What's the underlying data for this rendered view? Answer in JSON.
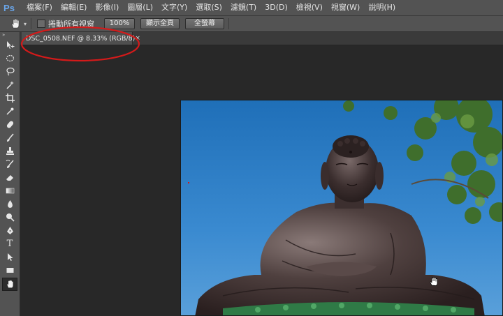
{
  "app": {
    "logo": "Ps"
  },
  "menu": {
    "items": [
      {
        "label": "檔案(F)"
      },
      {
        "label": "編輯(E)"
      },
      {
        "label": "影像(I)"
      },
      {
        "label": "圖層(L)"
      },
      {
        "label": "文字(Y)"
      },
      {
        "label": "選取(S)"
      },
      {
        "label": "濾鏡(T)"
      },
      {
        "label": "3D(D)"
      },
      {
        "label": "檢視(V)"
      },
      {
        "label": "視窗(W)"
      },
      {
        "label": "說明(H)"
      }
    ]
  },
  "options": {
    "scroll_all_windows_label": "捲動所有視窗",
    "zoom_100_label": "100%",
    "fit_screen_label": "顯示全頁",
    "fill_screen_label": "全螢幕"
  },
  "document": {
    "tab_title": "DSC_0508.NEF @ 8.33% (RGB/8)",
    "close_glyph": "×"
  },
  "tools": [
    {
      "icon": "move-icon"
    },
    {
      "icon": "marquee-icon"
    },
    {
      "icon": "lasso-icon"
    },
    {
      "icon": "magic-wand-icon"
    },
    {
      "icon": "crop-icon"
    },
    {
      "icon": "eyedropper-icon"
    },
    {
      "icon": "healing-brush-icon"
    },
    {
      "icon": "brush-icon"
    },
    {
      "icon": "clone-stamp-icon"
    },
    {
      "icon": "history-brush-icon"
    },
    {
      "icon": "eraser-icon"
    },
    {
      "icon": "gradient-icon"
    },
    {
      "icon": "blur-icon"
    },
    {
      "icon": "dodge-icon"
    },
    {
      "icon": "pen-icon"
    },
    {
      "icon": "type-icon",
      "glyph": "T"
    },
    {
      "icon": "path-selection-icon"
    },
    {
      "icon": "rectangle-shape-icon"
    },
    {
      "icon": "hand-icon",
      "active": true
    }
  ],
  "colors": {
    "annotation": "#d41a1a",
    "sky": "#2e7fc4",
    "accent_logo": "#6aa6ea"
  }
}
